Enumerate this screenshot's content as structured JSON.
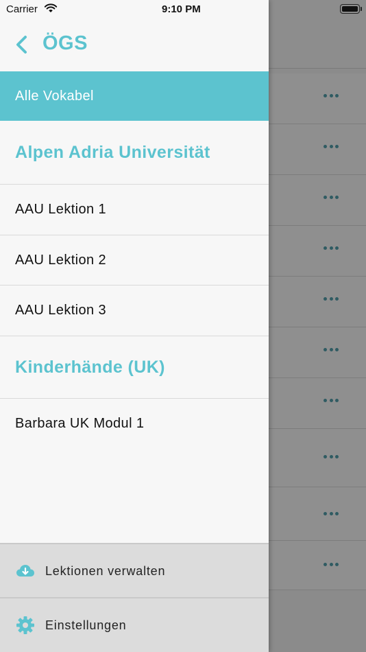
{
  "status_bar": {
    "carrier": "Carrier",
    "time": "9:10 PM"
  },
  "drawer": {
    "title": "ÖGS",
    "items": [
      {
        "label": "Alle Vokabel",
        "kind": "active"
      },
      {
        "label": "Alpen Adria Universität",
        "kind": "section"
      },
      {
        "label": "AAU Lektion 1",
        "kind": "item"
      },
      {
        "label": "AAU Lektion 2",
        "kind": "item"
      },
      {
        "label": "AAU Lektion 3",
        "kind": "item"
      },
      {
        "label": "Kinderhände (UK)",
        "kind": "section"
      },
      {
        "label": "Barbara UK Modul 1",
        "kind": "item"
      }
    ],
    "footer": {
      "manage_label": "Lektionen verwalten",
      "manage_icon": "cloud-download-icon",
      "settings_label": "Einstellungen",
      "settings_icon": "gear-icon"
    }
  },
  "background_list": {
    "row_action_icon": "more-dots-icon"
  },
  "colors": {
    "accent": "#5cc3cf",
    "drawer_background": "#f7f7f7",
    "footer_background": "#dcdcdc",
    "dimmed_background": "#8b8b8b"
  }
}
